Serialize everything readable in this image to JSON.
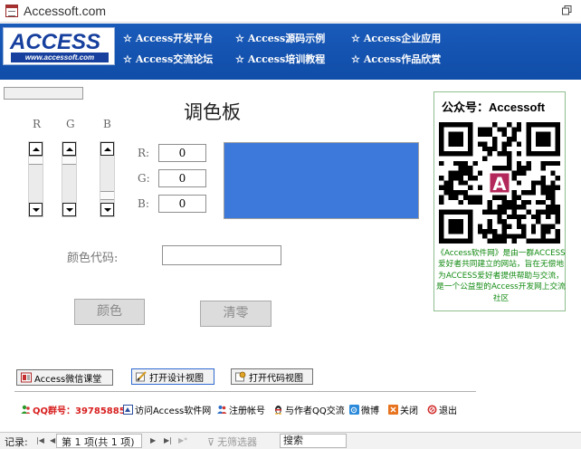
{
  "window": {
    "title": "Accessoft.com"
  },
  "banner": {
    "logo_text": "ACCESS",
    "logo_url": "www.accessoft.com",
    "nav": [
      {
        "label": "Access开发平台"
      },
      {
        "label": "Access源码示例"
      },
      {
        "label": "Access企业应用"
      },
      {
        "label": "Access交流论坛"
      },
      {
        "label": "Access培训教程"
      },
      {
        "label": "Access作品欣赏"
      }
    ],
    "star": "☆",
    "color": "#1a5ab9"
  },
  "palette": {
    "title": "调色板",
    "columns": [
      "R",
      "G",
      "B"
    ],
    "fields": [
      {
        "label": "R:",
        "value": "0"
      },
      {
        "label": "G:",
        "value": "0"
      },
      {
        "label": "B:",
        "value": "0"
      }
    ],
    "preview_color": "#3d78db",
    "code_label": "颜色代码:",
    "code_value": "",
    "color_button": "颜色",
    "clear_button": "清零"
  },
  "side_panel": {
    "title": "公众号：Accessoft",
    "text": "《Access软件网》是由一群ACCESS爱好者共同建立的网站，旨在无偿地为ACCESS爱好者提供帮助与交流，是一个公益型的Access开发网上交流社区"
  },
  "actions": {
    "wechat_class": "Access微信课堂",
    "open_design": "打开设计视图",
    "open_code": "打开代码视图"
  },
  "links": {
    "qq_group": "QQ群号：39785885",
    "visit_site": "访问Access软件网",
    "register": "注册帐号",
    "contact_author": "与作者QQ交流",
    "weibo": "微博",
    "close": "关闭",
    "exit": "退出"
  },
  "statusbar": {
    "record_label": "记录:",
    "record_value": "第 1 项(共 1 项)",
    "no_filter": "无筛选器",
    "search": "搜索"
  }
}
